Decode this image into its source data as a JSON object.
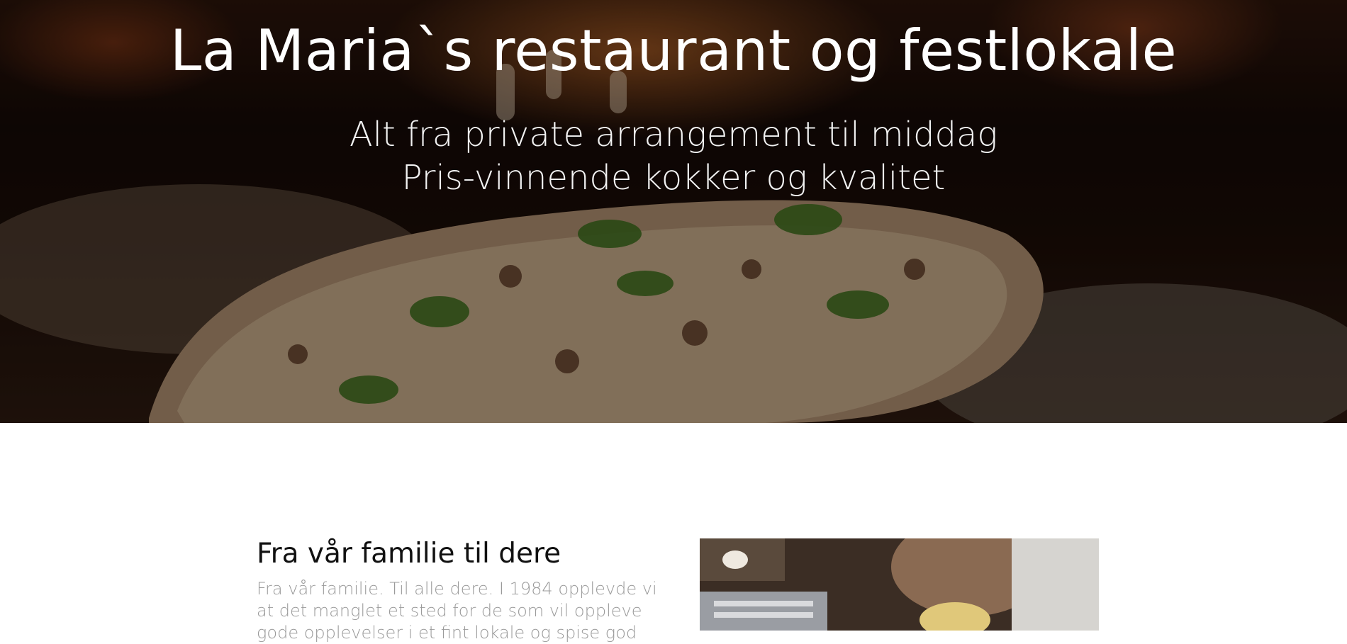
{
  "hero": {
    "title": "La Maria`s restaurant og festlokale",
    "subtitle_line1": "Alt fra private arrangement til middag",
    "subtitle_line2": "Pris-vinnende kokker og kvalitet"
  },
  "about": {
    "heading": "Fra vår familie til dere",
    "body": "Fra vår familie. Til alle dere. I 1984 opplevde vi at det manglet et sted for de som vil oppleve gode opplevelser i et fint lokale og spise god"
  },
  "colors": {
    "hero_text": "#ffffff",
    "heading_text": "#111111",
    "body_text": "#9a9a9a",
    "page_background": "#ffffff"
  }
}
